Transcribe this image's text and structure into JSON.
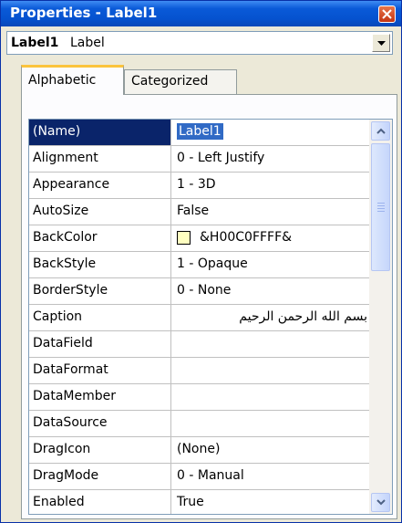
{
  "window": {
    "title": "Properties - Label1"
  },
  "object_selector": {
    "name": "Label1",
    "type": "Label"
  },
  "tabs": [
    {
      "label": "Alphabetic",
      "active": true
    },
    {
      "label": "Categorized",
      "active": false
    }
  ],
  "properties": [
    {
      "name": "(Name)",
      "value": "Label1",
      "selected": true
    },
    {
      "name": "Alignment",
      "value": "0 - Left Justify"
    },
    {
      "name": "Appearance",
      "value": "1 - 3D"
    },
    {
      "name": "AutoSize",
      "value": "False"
    },
    {
      "name": "BackColor",
      "value": "&H00C0FFFF&",
      "swatch_color": "#ffffc0"
    },
    {
      "name": "BackStyle",
      "value": "1 - Opaque"
    },
    {
      "name": "BorderStyle",
      "value": "0 - None"
    },
    {
      "name": "Caption",
      "value": "بسم الله الرحمن الرحيم"
    },
    {
      "name": "DataField",
      "value": ""
    },
    {
      "name": "DataFormat",
      "value": ""
    },
    {
      "name": "DataMember",
      "value": ""
    },
    {
      "name": "DataSource",
      "value": ""
    },
    {
      "name": "DragIcon",
      "value": "(None)"
    },
    {
      "name": "DragMode",
      "value": "0 - Manual"
    },
    {
      "name": "Enabled",
      "value": "True"
    }
  ],
  "colors": {
    "title_bar": "#0552cf",
    "selection": "#0a246a",
    "tab_highlight": "#fbc43c"
  }
}
